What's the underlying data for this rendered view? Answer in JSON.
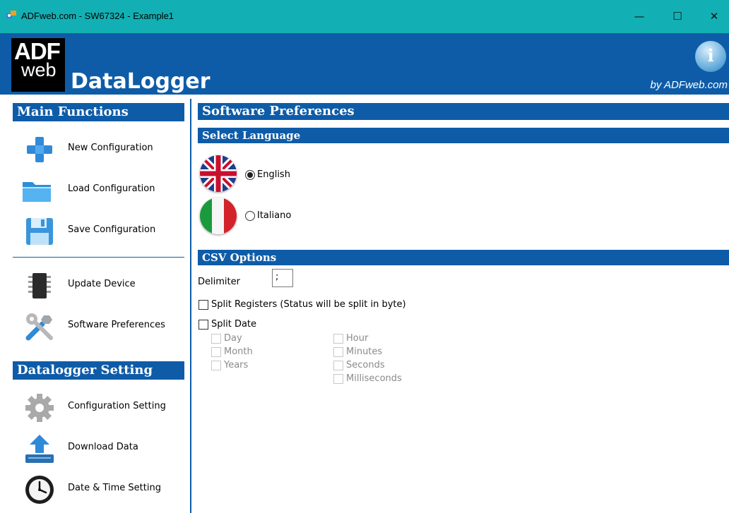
{
  "window": {
    "title": "ADFweb.com - SW67324 - Example1",
    "minimize_glyph": "—",
    "maximize_glyph": "☐",
    "close_glyph": "✕"
  },
  "header": {
    "logo_top": "ADF",
    "logo_bottom": "web",
    "app_name": "DataLogger",
    "byline": "by ADFweb.com",
    "info_glyph": "i"
  },
  "sidebar": {
    "main_functions_title": "Main Functions",
    "main_items": [
      {
        "label": "New Configuration",
        "icon": "plus-icon"
      },
      {
        "label": "Load Configuration",
        "icon": "folder-icon"
      },
      {
        "label": "Save Configuration",
        "icon": "floppy-disk-icon"
      },
      {
        "label": "Update Device",
        "icon": "chip-icon"
      },
      {
        "label": "Software Preferences",
        "icon": "tools-icon"
      }
    ],
    "datalogger_title": "Datalogger Setting",
    "datalogger_items": [
      {
        "label": "Configuration Setting",
        "icon": "gear-icon"
      },
      {
        "label": "Download Data",
        "icon": "download-icon"
      },
      {
        "label": "Date & Time Setting",
        "icon": "clock-icon"
      }
    ]
  },
  "main": {
    "title": "Software Preferences",
    "language_section": "Select Language",
    "languages": [
      {
        "label": "English",
        "selected": true
      },
      {
        "label": "Italiano",
        "selected": false
      }
    ],
    "csv_section": "CSV Options",
    "delimiter_label": "Delimiter",
    "delimiter_value": ";",
    "split_registers_label": "Split Registers (Status will be split in byte)",
    "split_registers_checked": false,
    "split_date_label": "Split Date",
    "split_date_checked": false,
    "date_parts_left": [
      "Day",
      "Month",
      "Years"
    ],
    "date_parts_right": [
      "Hour",
      "Minutes",
      "Seconds",
      "Milliseconds"
    ]
  },
  "colors": {
    "titlebar": "#12b0b4",
    "brand_blue": "#0e5ca8"
  }
}
